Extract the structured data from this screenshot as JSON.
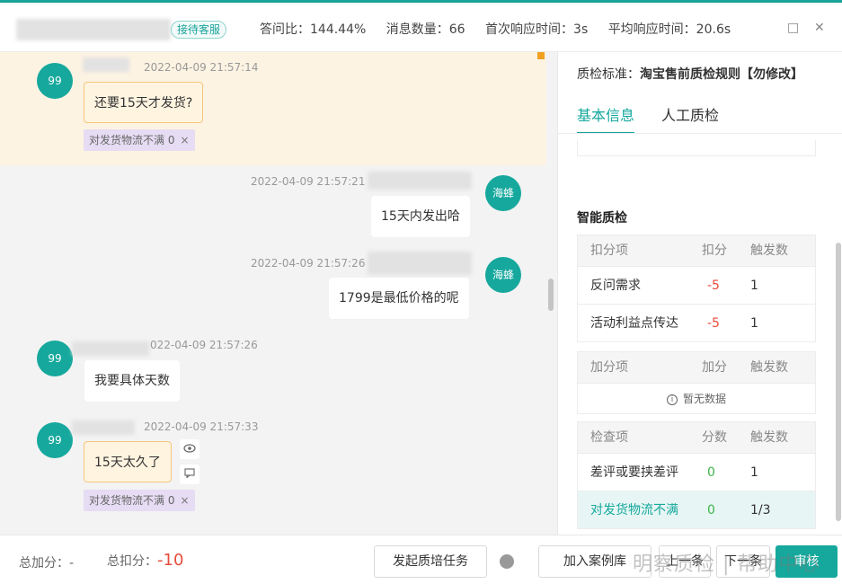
{
  "header": {
    "tag": "接待客服",
    "stats": [
      "答问比：144.44%",
      "消息数量：66",
      "首次响应时间：3s",
      "平均响应时间：20.6s"
    ],
    "restore_icon": "□",
    "close_icon": "✕"
  },
  "chat": {
    "messages": [
      {
        "avatar": "99",
        "time": "2022-04-09 21:57:14",
        "text": "还要15天才发货?",
        "chip": "对发货物流不满 0"
      },
      {
        "avatar": "海蜂",
        "time": "2022-04-09 21:57:21",
        "text": "15天内发出哈"
      },
      {
        "avatar": "海蜂",
        "time": "2022-04-09 21:57:26",
        "text": "1799是最低价格的呢"
      },
      {
        "avatar": "99",
        "time": "022-04-09 21:57:26",
        "text": "我要具体天数"
      },
      {
        "avatar": "99",
        "time": "2022-04-09 21:57:33",
        "text": "15天太久了",
        "chip": "对发货物流不满 0"
      }
    ],
    "chip_close": "×"
  },
  "panel": {
    "standard_label": "质检标准：",
    "standard_value": "淘宝售前质检规则【勿修改】",
    "tabs": [
      "基本信息",
      "人工质检"
    ],
    "section_title": "智能质检",
    "deduct": {
      "headers": [
        "扣分项",
        "扣分",
        "触发数"
      ],
      "rows": [
        {
          "name": "反问需求",
          "score": "-5",
          "count": "1"
        },
        {
          "name": "活动利益点传达",
          "score": "-5",
          "count": "1"
        }
      ]
    },
    "bonus": {
      "headers": [
        "加分项",
        "加分",
        "触发数"
      ],
      "empty": "暂无数据"
    },
    "check": {
      "headers": [
        "检查项",
        "分数",
        "触发数"
      ],
      "rows": [
        {
          "name": "差评或要挟差评",
          "score": "0",
          "count": "1"
        },
        {
          "name": "对发货物流不满",
          "score": "0",
          "count": "1/3"
        }
      ]
    }
  },
  "footer": {
    "total_add_label": "总加分：",
    "total_add_value": "-",
    "total_deduct_label": "总扣分：",
    "total_deduct_value": "-10",
    "btn_training": "发起质培任务",
    "btn_case": "加入案例库",
    "btn_prev": "上一条",
    "btn_next": "下一条",
    "btn_submit": "审核"
  },
  "watermark": "明察质检 | 帮助中心"
}
